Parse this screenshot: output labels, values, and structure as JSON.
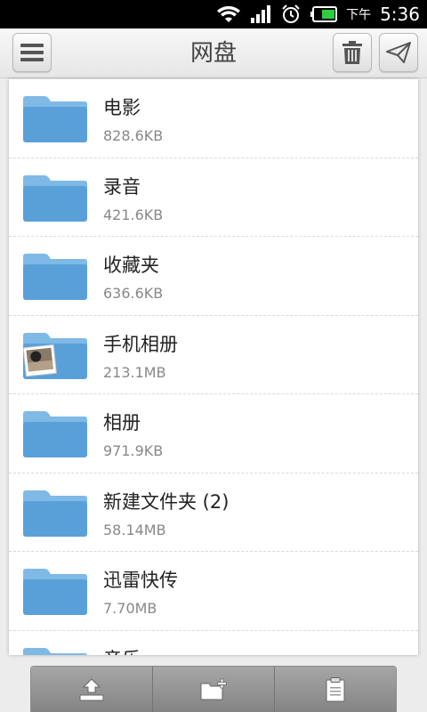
{
  "status_bar": {
    "ampm": "下午",
    "time": "5:36"
  },
  "header": {
    "title": "网盘",
    "icons": [
      "menu-icon",
      "trash-icon",
      "send-icon"
    ]
  },
  "files": [
    {
      "name": "电影",
      "size": "828.6KB",
      "icon": "folder-icon"
    },
    {
      "name": "录音",
      "size": "421.6KB",
      "icon": "folder-icon"
    },
    {
      "name": "收藏夹",
      "size": "636.6KB",
      "icon": "folder-icon"
    },
    {
      "name": "手机相册",
      "size": "213.1MB",
      "icon": "photo-folder-icon"
    },
    {
      "name": "相册",
      "size": "971.9KB",
      "icon": "folder-icon"
    },
    {
      "name": "新建文件夹 (2)",
      "size": "58.14MB",
      "icon": "folder-icon"
    },
    {
      "name": "迅雷快传",
      "size": "7.70MB",
      "icon": "folder-icon"
    },
    {
      "name": "音乐",
      "size": "",
      "icon": "folder-icon"
    }
  ],
  "toolbar": {
    "icons": [
      "upload-icon",
      "new-folder-icon",
      "clipboard-icon"
    ]
  },
  "colors": {
    "folder_blue": "#5aa0d8",
    "folder_blue_light": "#7fb9e6"
  }
}
